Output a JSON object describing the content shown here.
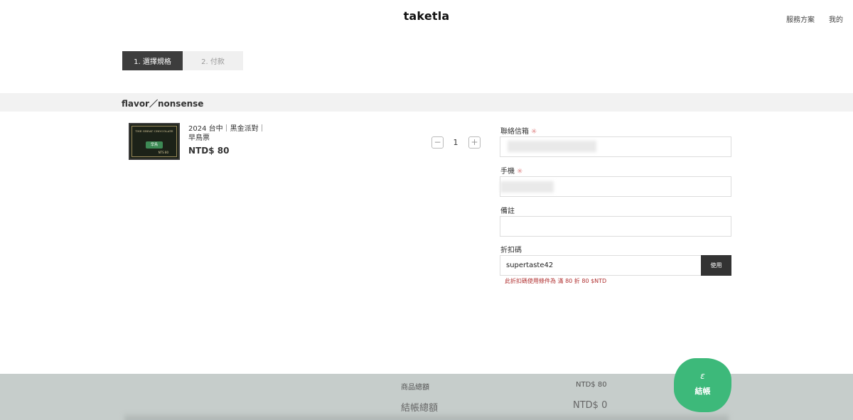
{
  "header": {
    "logo": "taketla",
    "nav": [
      "服務方案",
      "我的"
    ]
  },
  "steps": [
    {
      "label": "1. 選擇規格",
      "active": true
    },
    {
      "label": "2. 付款",
      "active": false
    }
  ],
  "shop": {
    "name": "flavor／nonsense"
  },
  "product": {
    "title": "2024 台中｜黑金派對｜早鳥票",
    "price": "NTD$ 80",
    "quantity": "1",
    "minus_symbol": "−",
    "plus_symbol": "+",
    "thumbnail": {
      "line1": "THE GREAT CHOCOLATE",
      "badge": "早鳥",
      "price_text": "NTS 80"
    }
  },
  "form": {
    "email": {
      "label": "聯絡信箱",
      "required_mark": "✳"
    },
    "phone": {
      "label": "手機",
      "required_mark": "✳"
    },
    "note": {
      "label": "備註"
    },
    "coupon": {
      "label": "折扣碼",
      "value": "supertaste42",
      "button": "使用",
      "message": "此折扣碼使用條件為 滿 80 折 80 $NTD"
    }
  },
  "summary": {
    "subtotal_label": "商品總額",
    "subtotal_value": "NTD$ 80",
    "total_label": "結帳總額",
    "total_value": "NTD$ 0",
    "checkout_icon": "ɛ",
    "checkout_label": "結帳"
  },
  "colors": {
    "accent_green": "#3db97a",
    "active_step": "#3d3d3d",
    "error_text": "#b03030",
    "bottom_bar": "#c6cdcb"
  }
}
